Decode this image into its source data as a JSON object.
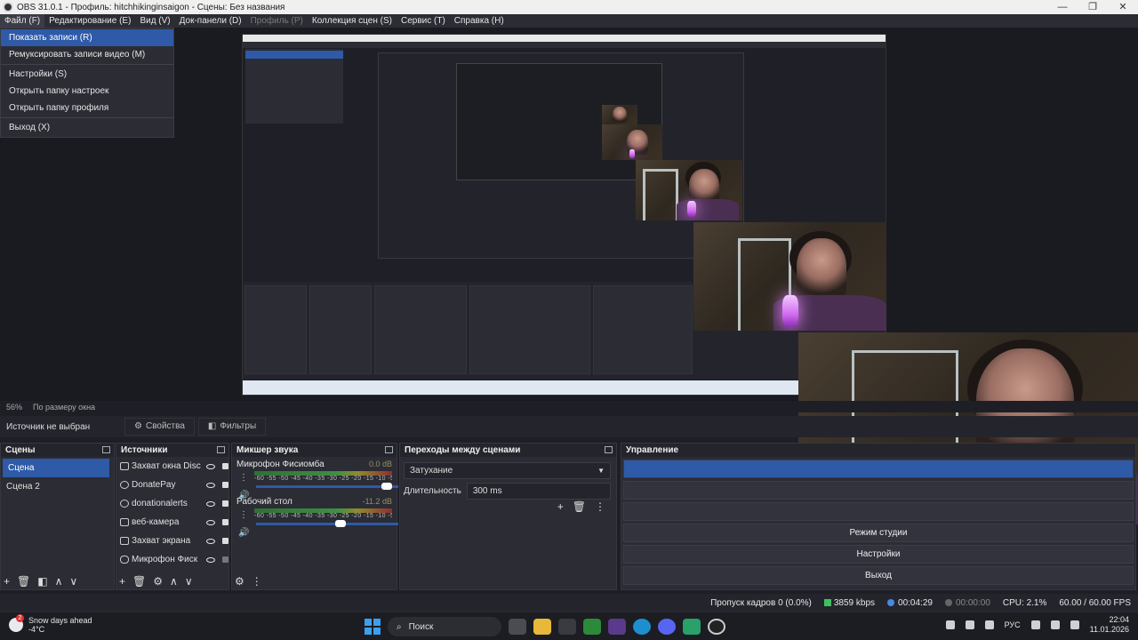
{
  "window": {
    "title": "OBS 31.0.1 - Профиль: hitchhikinginsaigon - Сцены: Без названия",
    "controls": [
      "—",
      "❐",
      "✕"
    ]
  },
  "menu": [
    {
      "label": "Файл (F)",
      "active": true
    },
    {
      "label": "Редактирование (E)"
    },
    {
      "label": "Вид (V)"
    },
    {
      "label": "Док-панели (D)"
    },
    {
      "label": "Профиль (P)",
      "disabled": true
    },
    {
      "label": "Коллекция сцен (S)"
    },
    {
      "label": "Сервис (T)"
    },
    {
      "label": "Справка (H)"
    }
  ],
  "file_menu": {
    "show_recordings": "Показать записи (R)",
    "remux": "Ремуксировать записи видео (M)",
    "settings": "Настройки (S)",
    "open_settings_folder": "Открыть папку настроек",
    "open_profile_folder": "Открыть папку профиля",
    "exit": "Выход (X)"
  },
  "preview": {
    "zoom": "56%",
    "scale_mode": "По размеру окна"
  },
  "properties_bar": {
    "no_source": "Источник не выбран",
    "properties": "Свойства",
    "filters": "Фильтры"
  },
  "scenes": {
    "title": "Сцены",
    "items": [
      "Сцена",
      "Сцена 2"
    ]
  },
  "sources": {
    "title": "Источники",
    "items": [
      "Захват окна Disc",
      "DonatePay",
      "donationalerts",
      "веб-камера",
      "Захват экрана",
      "Микрофон Фиск"
    ]
  },
  "mixer": {
    "title": "Микшер звука",
    "ticks": "-60 -55 -50 -45 -40 -35 -30 -25 -20 -15 -10 -5 0",
    "channels": [
      {
        "name": "Микрофон Фисиомба",
        "db": "0.0 dB",
        "level": 0.95
      },
      {
        "name": "Рабочий стол",
        "db": "-11.2 dB",
        "level": 0.6
      }
    ]
  },
  "transitions": {
    "title": "Переходы между сценами",
    "selected": "Затухание",
    "duration_label": "Длительность",
    "duration_value": "300 ms"
  },
  "controls": {
    "title": "Управление",
    "studio_mode": "Режим студии",
    "settings": "Настройки",
    "exit": "Выход"
  },
  "status": {
    "dropped_frames": "Пропуск кадров 0 (0.0%)",
    "bitrate": "3859 kbps",
    "stream_time": "00:04:29",
    "rec_time": "00:00:00",
    "cpu": "CPU: 2.1%",
    "fps": "60.00 / 60.00 FPS"
  },
  "taskbar": {
    "weather_title": "Snow days ahead",
    "weather_temp": "-4°C",
    "weather_badge": "2",
    "search": "Поиск",
    "lang": "РУС",
    "time": "22:04",
    "date": "11.01.2026"
  },
  "colors": {
    "accent": "#2e5aa8",
    "panel": "#2b2c34",
    "background": "#1e1f26"
  }
}
